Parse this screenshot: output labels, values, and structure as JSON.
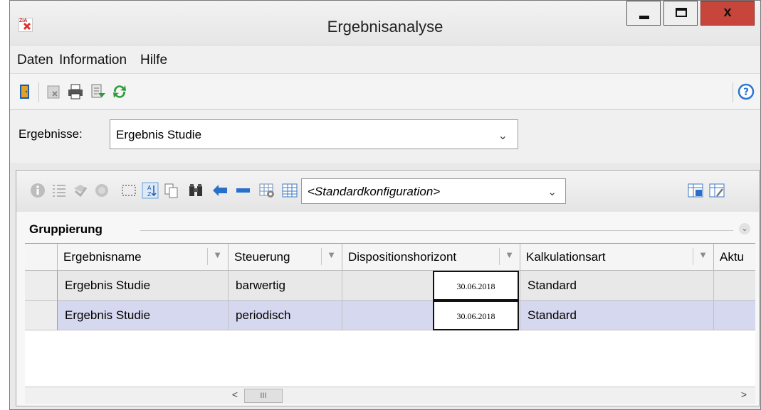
{
  "window": {
    "title": "Ergebnisanalyse",
    "app_icon_text": "ZIA",
    "buttons": {
      "minimize": "_",
      "maximize": "□",
      "close": "x"
    }
  },
  "menu": [
    "Daten",
    "Information",
    "Hilfe"
  ],
  "toolbar": {
    "icons": [
      "exit-door-icon",
      "delete-icon",
      "print-icon",
      "export-icon",
      "refresh-icon"
    ],
    "help_icon": "help-icon"
  },
  "filter": {
    "label": "Ergebnisse:",
    "selected": "Ergebnis Studie"
  },
  "grid_toolbar": {
    "icons": [
      "info-icon",
      "list-icon",
      "select-icon",
      "globe-icon",
      "dotted-selection-icon",
      "sort-icon",
      "copy-icon",
      "binoculars-icon",
      "move-icon",
      "collapse-icon",
      "config-settings-icon",
      "table-icon",
      "save-config-icon",
      "edit-config-icon"
    ],
    "config": "<Standardkonfiguration>"
  },
  "grouping": {
    "label": "Gruppierung"
  },
  "table": {
    "columns": [
      "Ergebnisname",
      "Steuerung",
      "Dispositionshorizont",
      "Kalkulationsart",
      "Aktu"
    ],
    "rows": [
      {
        "Ergebnisname": "Ergebnis Studie",
        "Steuerung": "barwertig",
        "Dispositionshorizont": "30.06.2018",
        "Kalkulationsart": "Standard",
        "selected": false
      },
      {
        "Ergebnisname": "Ergebnis Studie",
        "Steuerung": "periodisch",
        "Dispositionshorizont": "30.06.2018",
        "Kalkulationsart": "Standard",
        "selected": true
      }
    ]
  },
  "scrollbar": {
    "left": "<",
    "thumb": "III",
    "right": ">"
  },
  "colors": {
    "close": "#c7453a",
    "selected_row": "#d5d8ef",
    "row": "#e8e8e8",
    "help": "#2b76d0"
  }
}
